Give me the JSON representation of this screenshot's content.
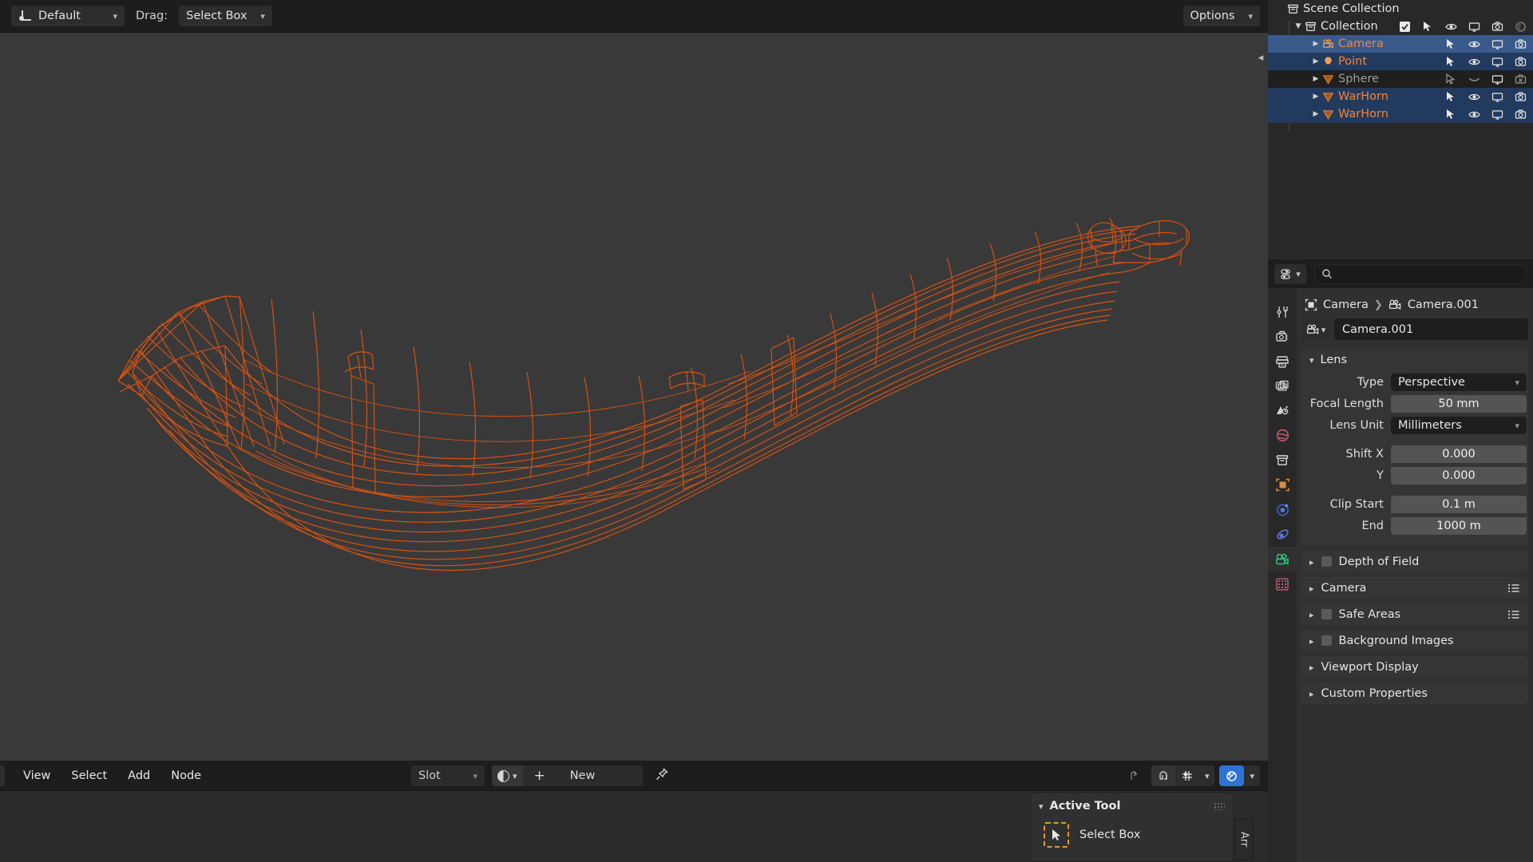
{
  "topbar": {
    "tool_preset": "Default",
    "drag_label": "Drag:",
    "drag_mode": "Select Box",
    "options": "Options"
  },
  "viewport": {
    "background_color": "#393939",
    "wireframe_color": "#e2540f",
    "object": "WarHorn"
  },
  "node_editor": {
    "menus": [
      "View",
      "Select",
      "Add",
      "Node"
    ],
    "slot_label": "Slot",
    "new_button": "New",
    "plus": "+"
  },
  "active_tool_panel": {
    "title": "Active Tool",
    "tool_name": "Select Box",
    "side_tab": "Arr"
  },
  "outliner": {
    "rows": [
      {
        "name": "Scene Collection",
        "indent": 0,
        "style": "white",
        "disclosure": "none",
        "selection": "none",
        "icon": "collection-icon",
        "checkbox": false,
        "icons": []
      },
      {
        "name": "Collection",
        "indent": 1,
        "style": "white",
        "disclosure": "open",
        "selection": "none",
        "icon": "collection-icon",
        "checkbox": true,
        "icons": [
          "cursor-icon",
          "eye-icon",
          "screen-icon",
          "camera-icon",
          "holdout-icon"
        ]
      },
      {
        "name": "Camera",
        "indent": 2,
        "style": "orange-b",
        "disclosure": "closed",
        "selection": "active",
        "icon": "camera-object-icon",
        "checkbox": false,
        "icons": [
          "cursor-icon",
          "eye-icon",
          "screen-icon",
          "camera-icon"
        ]
      },
      {
        "name": "Point",
        "indent": 2,
        "style": "orange-b",
        "disclosure": "closed",
        "selection": "selected",
        "icon": "light-icon",
        "checkbox": false,
        "icons": [
          "cursor-icon",
          "eye-icon",
          "screen-icon",
          "camera-icon"
        ]
      },
      {
        "name": "Sphere",
        "indent": 2,
        "style": "grey",
        "disclosure": "closed",
        "selection": "dim",
        "icon": "mesh-icon",
        "checkbox": false,
        "icons": [
          "cursor-off-icon",
          "eye-closed-icon",
          "screen-icon",
          "camera-off-icon"
        ]
      },
      {
        "name": "WarHorn",
        "indent": 2,
        "style": "orange-b",
        "disclosure": "closed",
        "selection": "selected",
        "icon": "mesh-icon",
        "checkbox": false,
        "icons": [
          "cursor-icon",
          "eye-icon",
          "screen-icon",
          "camera-icon"
        ]
      },
      {
        "name": "WarHorn",
        "indent": 2,
        "style": "orange-b",
        "disclosure": "closed",
        "selection": "selected",
        "icon": "mesh-icon",
        "checkbox": false,
        "icons": [
          "cursor-icon",
          "eye-icon",
          "screen-icon",
          "camera-icon"
        ]
      }
    ]
  },
  "properties": {
    "search_placeholder": "",
    "breadcrumb": {
      "root": "Camera",
      "leaf": "Camera.001"
    },
    "id_name": "Camera.001",
    "tabs": [
      "tool-tab",
      "render-tab",
      "output-tab",
      "view-layer-tab",
      "scene-tab",
      "world-tab",
      "collection-tab",
      "object-tab",
      "modifier-tab",
      "physics-tab",
      "object-data-camera-tab",
      "texture-tab"
    ],
    "active_tab": "object-data-camera-tab",
    "lens_panel": {
      "title": "Lens",
      "fields": [
        {
          "label": "Type",
          "value": "Perspective",
          "kind": "dropdown"
        },
        {
          "label": "Focal Length",
          "value": "50 mm",
          "kind": "number"
        },
        {
          "label": "Lens Unit",
          "value": "Millimeters",
          "kind": "dropdown"
        },
        {
          "label": "Shift X",
          "value": "0.000",
          "kind": "number"
        },
        {
          "label": "Y",
          "value": "0.000",
          "kind": "number"
        },
        {
          "label": "Clip Start",
          "value": "0.1 m",
          "kind": "number"
        },
        {
          "label": "End",
          "value": "1000 m",
          "kind": "number"
        }
      ]
    },
    "collapsed_panels": [
      {
        "title": "Depth of Field",
        "checkbox": true,
        "list_icon": false
      },
      {
        "title": "Camera",
        "checkbox": false,
        "list_icon": true
      },
      {
        "title": "Safe Areas",
        "checkbox": true,
        "list_icon": true
      },
      {
        "title": "Background Images",
        "checkbox": true,
        "list_icon": false
      },
      {
        "title": "Viewport Display",
        "checkbox": false,
        "list_icon": false
      },
      {
        "title": "Custom Properties",
        "checkbox": false,
        "list_icon": false
      }
    ]
  }
}
